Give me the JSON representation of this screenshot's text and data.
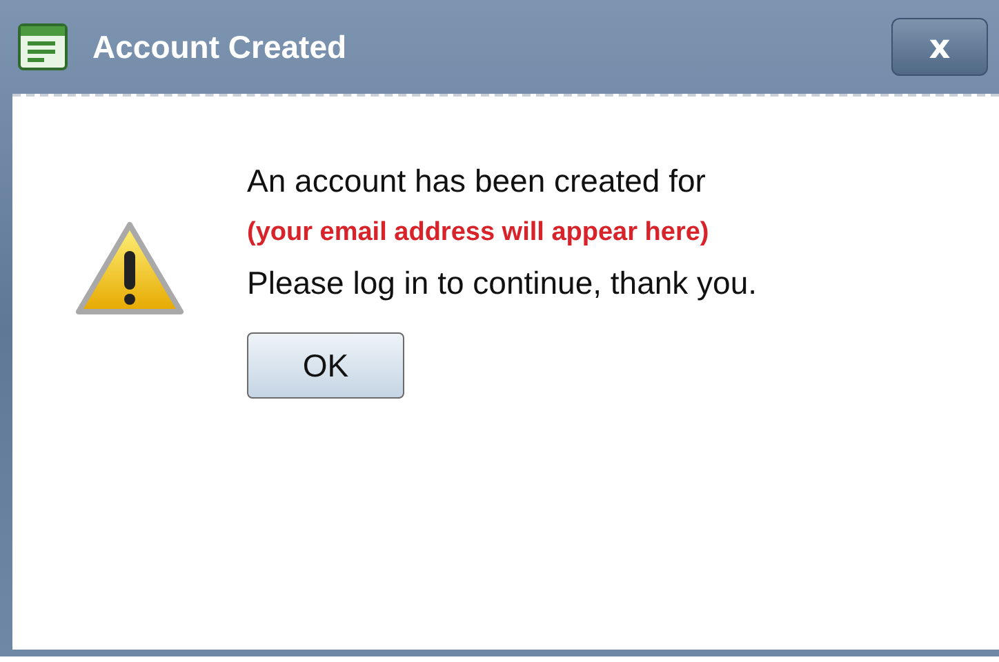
{
  "window": {
    "title": "Account Created",
    "close_label": "x"
  },
  "message": [
    {
      "kind": "plain",
      "text": "An account has been created for"
    },
    {
      "kind": "highlight",
      "text": "(your email address will appear here)"
    },
    {
      "kind": "plain",
      "text": "Please log in to continue, thank you."
    }
  ],
  "buttons": [
    "OK"
  ]
}
